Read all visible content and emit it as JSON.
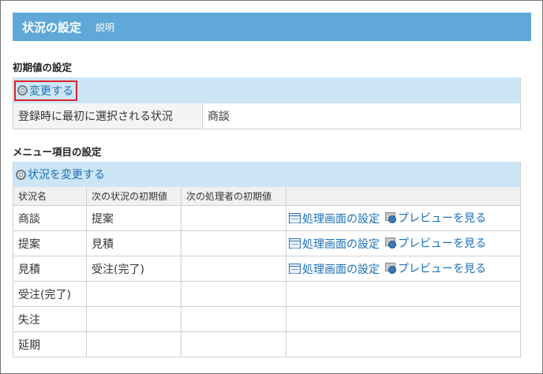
{
  "header": {
    "title": "状況の設定",
    "help": "説明"
  },
  "initial": {
    "section_title": "初期値の設定",
    "change_link": "変更する",
    "label": "登録時に最初に選択される状況",
    "value": "商談"
  },
  "menu": {
    "section_title": "メニュー項目の設定",
    "change_link": "状況を変更する",
    "columns": [
      "状況名",
      "次の状況の初期値",
      "次の処理者の初期値",
      ""
    ],
    "action_form": "処理画面の設定",
    "action_preview": "プレビューを見る",
    "rows": [
      {
        "name": "商談",
        "next": "提案"
      },
      {
        "name": "提案",
        "next": "見積"
      },
      {
        "name": "見積",
        "next": "受注(完了)"
      },
      {
        "name": "受注(完了)",
        "next": ""
      },
      {
        "name": "失注",
        "next": ""
      },
      {
        "name": "延期",
        "next": ""
      }
    ]
  }
}
